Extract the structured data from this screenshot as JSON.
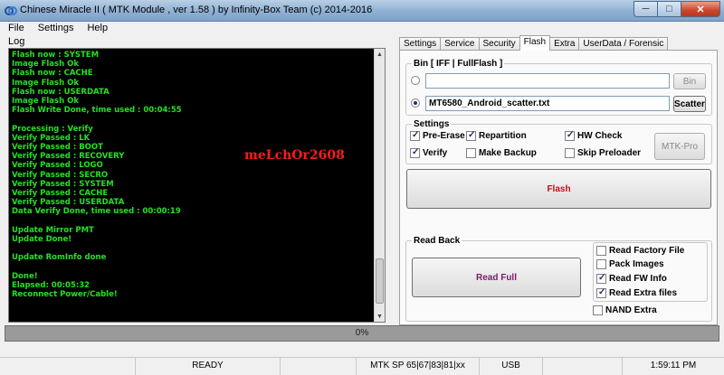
{
  "window": {
    "title": "Chinese Miracle II ( MTK Module , ver 1.58 ) by Infinity-Box Team (c) 2014-2016",
    "minimize_glyph": "─",
    "maximize_glyph": "□",
    "close_glyph": "✕"
  },
  "menu": [
    "File",
    "Settings",
    "Help"
  ],
  "log": {
    "label": "Log",
    "lines": [
      "Flash now : SYSTEM",
      "Image Flash Ok",
      "Flash now : CACHE",
      "Image Flash Ok",
      "Flash now : USERDATA",
      "Image Flash Ok",
      "Flash Write Done, time used : 00:04:55",
      "",
      "Processing : Verify",
      "Verify Passed : LK",
      "Verify Passed : BOOT",
      "Verify Passed : RECOVERY",
      "Verify Passed : LOGO",
      "Verify Passed : SECRO",
      "Verify Passed : SYSTEM",
      "Verify Passed : CACHE",
      "Verify Passed : USERDATA",
      "Data Verify Done, time used : 00:00:19",
      "",
      "Update Mirror PMT",
      "Update Done!",
      "",
      "Update RomInfo done",
      "",
      "Done!",
      "Elapsed: 00:05:32",
      "Reconnect Power/Cable!"
    ],
    "watermark": "meLchOr2608"
  },
  "tabs": [
    "Settings",
    "Service",
    "Security",
    "Flash",
    "Extra",
    "UserData / Forensic"
  ],
  "active_tab": "Flash",
  "bin": {
    "group_title": "Bin  [ IFF | FullFlash ]",
    "bin_value": "",
    "bin_button": "Bin",
    "scatter_value": "MT6580_Android_scatter.txt",
    "scatter_button": "Scatter"
  },
  "settings": {
    "group_title": "Settings",
    "checkboxes": [
      {
        "label": "Pre-Erase",
        "checked": true
      },
      {
        "label": "Repartition",
        "checked": true
      },
      {
        "label": "HW Check",
        "checked": true
      },
      {
        "label": "Verify",
        "checked": true
      },
      {
        "label": "Make Backup",
        "checked": false
      },
      {
        "label": "Skip Preloader",
        "checked": false
      }
    ],
    "mtk_pro_button": "MTK-Pro"
  },
  "flash_button": "Flash",
  "read_back": {
    "group_title": "Read Back",
    "read_full_button": "Read Full",
    "checkboxes": [
      {
        "label": "Read Factory File",
        "checked": false
      },
      {
        "label": "Pack Images",
        "checked": false
      },
      {
        "label": "Read FW Info",
        "checked": true
      },
      {
        "label": "Read Extra files",
        "checked": true
      }
    ],
    "nand_extra": {
      "label": "NAND Extra",
      "checked": false
    }
  },
  "progress": {
    "text": "0%",
    "value": 0
  },
  "status": {
    "state": "READY",
    "platform": "MTK SP 65|67|83|81|xx",
    "connection": "USB",
    "time": "1:59:11 PM"
  },
  "colors": {
    "log_text": "#22e222",
    "watermark": "#ff1a1a",
    "flash_text": "#c0101a",
    "read_full_text": "#7a1a6a"
  }
}
